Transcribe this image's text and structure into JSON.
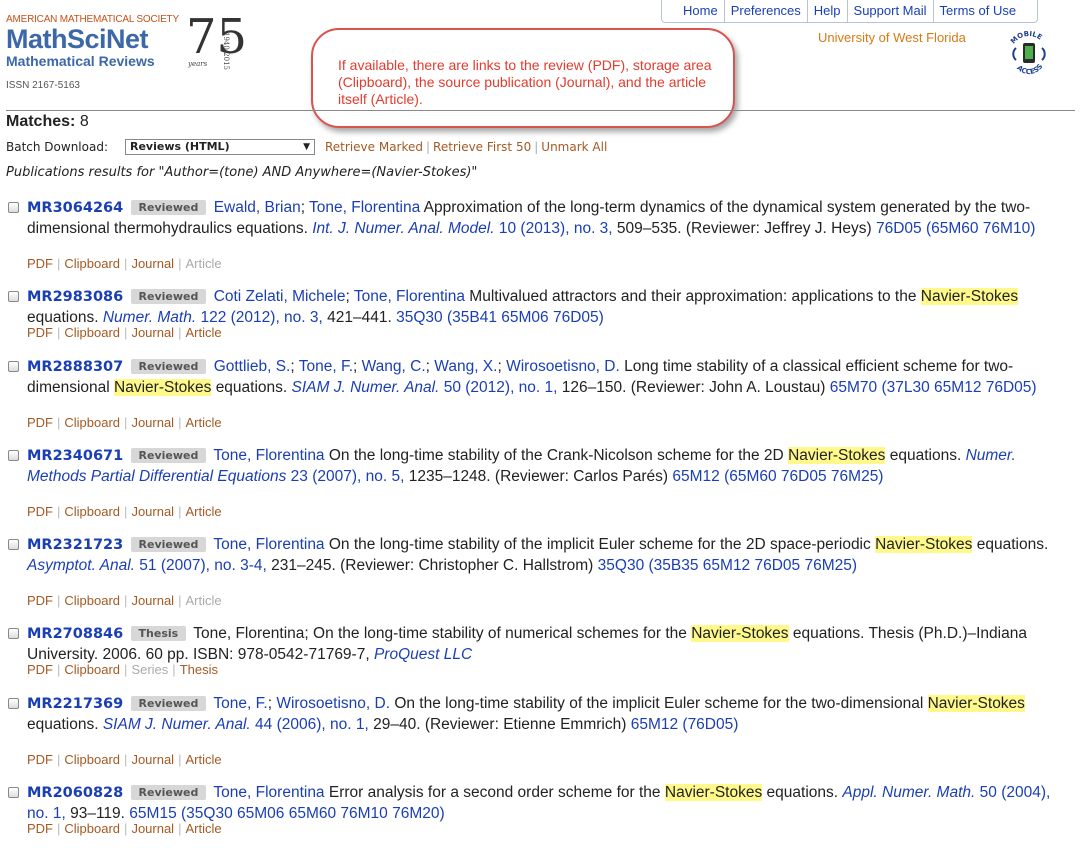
{
  "header": {
    "ams_label": "AMERICAN MATHEMATICAL SOCIETY",
    "brand": "MathSciNet",
    "subbrand": "Mathematical Reviews",
    "issn": "ISSN 2167-5163",
    "logo_number": "75",
    "logo_years": "years",
    "logo_range": "1940-2015",
    "university": "University of West Florida",
    "mobile_icon": "mobile-access-icon",
    "mobile_text": "MOBILE ACCESS"
  },
  "topnav": {
    "items": [
      "Home",
      "Preferences",
      "Help",
      "Support Mail",
      "Terms of Use"
    ]
  },
  "callout": {
    "text": "If available, there are links to the review (PDF), storage area (Clipboard), the source publication (Journal), and the article itself (Article)."
  },
  "controls": {
    "matches_label": "Matches:",
    "matches_count": "8",
    "batch_label": "Batch Download:",
    "batch_value": "Reviews (HTML)",
    "retrieve_marked": "Retrieve Marked",
    "retrieve_first": "Retrieve First 50",
    "unmark_all": "Unmark All",
    "pub_line": "Publications results for \"Author=(tone) AND Anywhere=(Navier-Stokes)\""
  },
  "results": [
    {
      "mr": "MR3064264",
      "badge": "Reviewed",
      "authors": [
        {
          "name": "Ewald, Brian",
          "linked": true
        },
        {
          "name": "Tone, Florentina",
          "linked": true
        }
      ],
      "title_parts": [
        "Approximation of the long-term dynamics of the dynamical system generated by the two-dimensional thermohydraulics equations."
      ],
      "source": "Int. J. Numer. Anal. Model.",
      "source_rest": "10 (2013), no. 3,",
      "pages": "509–535.",
      "reviewer": "(Reviewer: Jeffrey J. Heys)",
      "classes": "76D05 (65M60 76M10)",
      "links": [
        {
          "label": "PDF",
          "dim": false
        },
        {
          "label": "Clipboard",
          "dim": false
        },
        {
          "label": "Journal",
          "dim": false
        },
        {
          "label": "Article",
          "dim": true
        }
      ]
    },
    {
      "mr": "MR2983086",
      "badge": "Reviewed",
      "authors": [
        {
          "name": "Coti Zelati, Michele",
          "linked": true
        },
        {
          "name": "Tone, Florentina",
          "linked": true
        }
      ],
      "title_before": "Multivalued attractors and their approximation: applications to the",
      "highlight": "Navier-Stokes",
      "title_after": "equations.",
      "source": "Numer. Math.",
      "source_rest": "122 (2012), no. 3,",
      "pages": "421–441.",
      "reviewer": "",
      "classes": "35Q30 (35B41 65M06 76D05)",
      "links": [
        {
          "label": "PDF",
          "dim": false
        },
        {
          "label": "Clipboard",
          "dim": false
        },
        {
          "label": "Journal",
          "dim": false
        },
        {
          "label": "Article",
          "dim": false
        }
      ]
    },
    {
      "mr": "MR2888307",
      "badge": "Reviewed",
      "authors_text": [
        "Gottlieb, S.",
        "Tone, F.",
        "Wang, C.",
        "Wang, X.",
        "Wirosoetisno, D."
      ],
      "title_before": "Long time stability of a classical efficient scheme for two-dimensional",
      "highlight": "Navier-Stokes",
      "title_after": "equations.",
      "source": "SIAM J. Numer. Anal.",
      "source_rest": "50 (2012), no. 1,",
      "pages": "126–150.",
      "reviewer": "(Reviewer: John A. Loustau)",
      "classes": "65M70 (37L30 65M12 76D05)",
      "links": [
        {
          "label": "PDF",
          "dim": false
        },
        {
          "label": "Clipboard",
          "dim": false
        },
        {
          "label": "Journal",
          "dim": false
        },
        {
          "label": "Article",
          "dim": false
        }
      ]
    },
    {
      "mr": "MR2340671",
      "badge": "Reviewed",
      "authors_text": [
        "Tone, Florentina"
      ],
      "title_before": "On the long-time stability of the Crank-Nicolson scheme for the 2D",
      "highlight": "Navier-Stokes",
      "title_after": "equations.",
      "source": "Numer. Methods Partial Differential Equations",
      "source_rest": "23 (2007), no. 5,",
      "pages": "1235–1248.",
      "reviewer": "(Reviewer: Carlos Parés)",
      "classes": "65M12 (65M60 76D05 76M25)",
      "links": [
        {
          "label": "PDF",
          "dim": false
        },
        {
          "label": "Clipboard",
          "dim": false
        },
        {
          "label": "Journal",
          "dim": false
        },
        {
          "label": "Article",
          "dim": false
        }
      ]
    },
    {
      "mr": "MR2321723",
      "badge": "Reviewed",
      "authors_text": [
        "Tone, Florentina"
      ],
      "title_before": "On the long-time stability of the implicit Euler scheme for the 2D space-periodic",
      "highlight": "Navier-Stokes",
      "title_after": "equations.",
      "source": "Asymptot. Anal.",
      "source_rest": "51 (2007), no. 3-4,",
      "pages": "231–245.",
      "reviewer": "(Reviewer: Christopher C. Hallstrom)",
      "classes": "35Q30 (35B35 65M12 76D05 76M25)",
      "links": [
        {
          "label": "PDF",
          "dim": false
        },
        {
          "label": "Clipboard",
          "dim": false
        },
        {
          "label": "Journal",
          "dim": false
        },
        {
          "label": "Article",
          "dim": true
        }
      ]
    },
    {
      "mr": "MR2708846",
      "badge": "Thesis",
      "plain_author": "Tone, Florentina;",
      "title_before": "On the long-time stability of numerical schemes for the",
      "highlight": "Navier-Stokes",
      "title_after": "equations.",
      "thesis_info": "Thesis (Ph.D.)–Indiana University. 2006. 60 pp. ISBN: 978-0542-71769-7,",
      "publisher": "ProQuest LLC",
      "links": [
        {
          "label": "PDF",
          "dim": false
        },
        {
          "label": "Clipboard",
          "dim": false
        },
        {
          "label": "Series",
          "dim": true
        },
        {
          "label": "Thesis",
          "dim": false
        }
      ]
    },
    {
      "mr": "MR2217369",
      "badge": "Reviewed",
      "authors_text": [
        "Tone, F.",
        "Wirosoetisno, D."
      ],
      "title_before": "On the long-time stability of the implicit Euler scheme for the two-dimensional",
      "highlight": "Navier-Stokes",
      "title_after": "equations.",
      "source": "SIAM J. Numer. Anal.",
      "source_rest": "44 (2006), no. 1,",
      "pages": "29–40.",
      "reviewer": "(Reviewer: Etienne Emmrich)",
      "classes": "65M12 (76D05)",
      "links": [
        {
          "label": "PDF",
          "dim": false
        },
        {
          "label": "Clipboard",
          "dim": false
        },
        {
          "label": "Journal",
          "dim": false
        },
        {
          "label": "Article",
          "dim": false
        }
      ]
    },
    {
      "mr": "MR2060828",
      "badge": "Reviewed",
      "authors_text": [
        "Tone, Florentina"
      ],
      "title_before": "Error analysis for a second order scheme for the",
      "highlight": "Navier-Stokes",
      "title_after": "equations.",
      "source": "Appl. Numer. Math.",
      "source_rest": "50 (2004), no. 1,",
      "pages": "93–119.",
      "reviewer": "",
      "classes": "65M15 (35Q30 65M06 65M60 76M10 76M20)",
      "links": [
        {
          "label": "PDF",
          "dim": false
        },
        {
          "label": "Clipboard",
          "dim": false
        },
        {
          "label": "Journal",
          "dim": false
        },
        {
          "label": "Article",
          "dim": false
        }
      ]
    }
  ]
}
